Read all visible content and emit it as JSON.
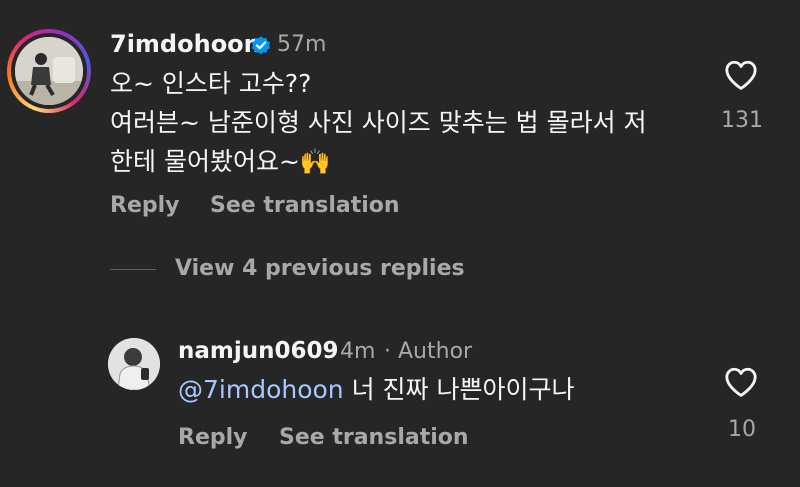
{
  "main_comment": {
    "username": "7imdohoon",
    "time": "57m",
    "lines": [
      "오~ 인스타 고수??",
      "여러븐~ 남준이형 사진 사이즈 맞추는 법 몰라서 저",
      "한테 물어봤어요~🙌"
    ],
    "reply_label": "Reply",
    "translate_label": "See translation",
    "like_count": "131"
  },
  "view_replies_label": "View 4 previous replies",
  "reply_comment": {
    "username": "namjun0609",
    "time": "4m",
    "separator": "·",
    "author_label": "Author",
    "mention": "@7imdohoon",
    "text": " 너 진짜 나쁜아이구나",
    "reply_label": "Reply",
    "translate_label": "See translation",
    "like_count": "10"
  },
  "colors": {
    "background": "#262626",
    "verified_badge": "#0095f6",
    "mention": "#a6c8ff",
    "muted_text": "#a8a8a8"
  },
  "icons": [
    "verified-badge-icon",
    "heart-icon",
    "raised-hands-emoji"
  ]
}
